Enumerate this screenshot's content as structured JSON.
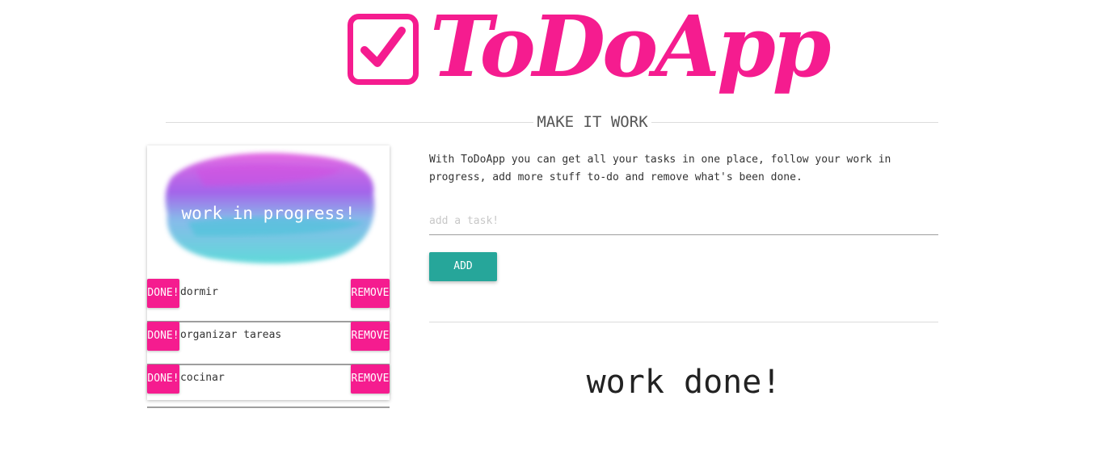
{
  "header": {
    "logo_text": "ToDoApp",
    "subtitle": "MAKE IT WORK"
  },
  "colors": {
    "brand_pink": "#f51c8f",
    "add_teal": "#26a69a"
  },
  "in_progress": {
    "title": "work in progress!",
    "done_label": "DONE!",
    "remove_label": "REMOVE",
    "tasks": [
      {
        "text": "dormir"
      },
      {
        "text": "organizar tareas"
      },
      {
        "text": "cocinar"
      }
    ]
  },
  "main": {
    "description": "With ToDoApp you can get all your tasks in one place, follow your work in progress, add more stuff to-do and remove what's been done.",
    "input_placeholder": "add a task!",
    "input_value": "",
    "add_label": "ADD",
    "done_title": "work done!"
  },
  "icons": {
    "logo_icon": "checkbox-check-icon"
  }
}
